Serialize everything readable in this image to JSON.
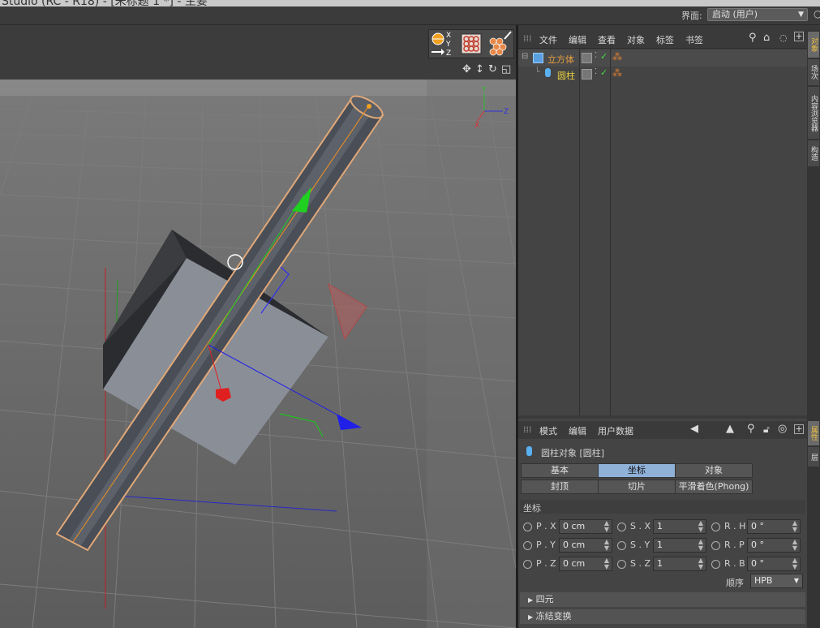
{
  "window": {
    "title": "Studio (RC - R18) - [未标题 1 *] - 主要"
  },
  "layout": {
    "label": "界面:",
    "value": "启动 (用户)"
  },
  "object_manager": {
    "menu": [
      "文件",
      "编辑",
      "查看",
      "对象",
      "标签",
      "书签"
    ],
    "objects": [
      {
        "name": "立方体",
        "color": "#e8a040",
        "icon": "cube-icon"
      },
      {
        "name": "圆柱",
        "color": "#e8d040",
        "icon": "cylinder-icon"
      }
    ]
  },
  "side_tabs": {
    "top": [
      "对象",
      "场次",
      "内容浏览器",
      "构造"
    ],
    "bottom": [
      "属性",
      "层"
    ]
  },
  "attributes": {
    "menu": [
      "模式",
      "编辑",
      "用户数据"
    ],
    "header": "圆柱对象 [圆柱]",
    "tabs": [
      {
        "label": "基本",
        "active": false
      },
      {
        "label": "坐标",
        "active": true
      },
      {
        "label": "对象",
        "active": false
      },
      {
        "label": "封顶",
        "active": false
      },
      {
        "label": "切片",
        "active": false
      },
      {
        "label": "平滑着色(Phong)",
        "active": false
      }
    ],
    "section": "坐标",
    "coords": [
      [
        {
          "label": "P . X",
          "value": "0 cm"
        },
        {
          "label": "S . X",
          "value": "1"
        },
        {
          "label": "R . H",
          "value": "0 °"
        }
      ],
      [
        {
          "label": "P . Y",
          "value": "0 cm"
        },
        {
          "label": "S . Y",
          "value": "1"
        },
        {
          "label": "R . P",
          "value": "0 °"
        }
      ],
      [
        {
          "label": "P . Z",
          "value": "0 cm"
        },
        {
          "label": "S . Z",
          "value": "1"
        },
        {
          "label": "R . B",
          "value": "0 °"
        }
      ]
    ],
    "order_label": "顺序",
    "order_value": "HPB",
    "groups": [
      "四元",
      "冻结变换"
    ]
  },
  "viewport": {
    "axis_labels": {
      "x": "X",
      "y": "Y",
      "z": "Z"
    }
  }
}
